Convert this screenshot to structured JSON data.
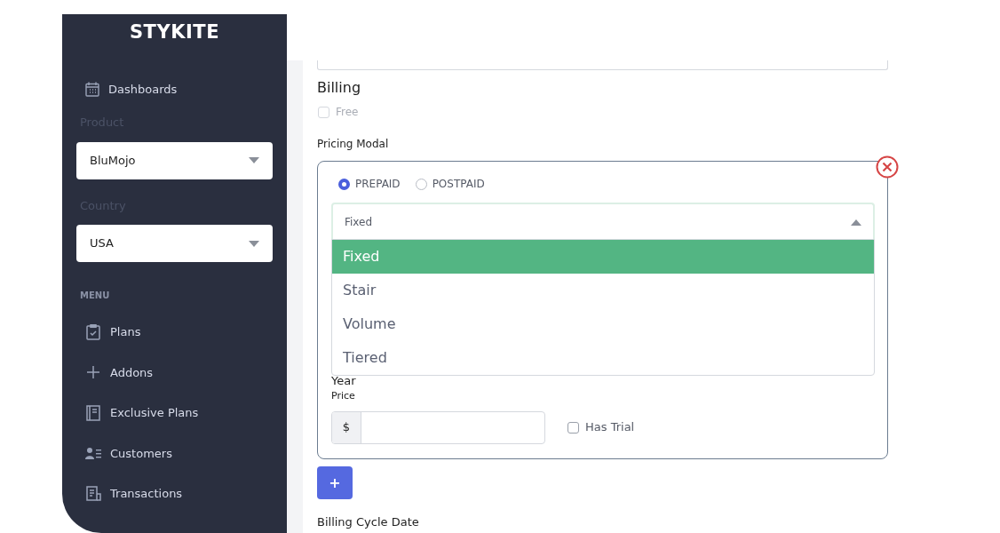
{
  "sidebar": {
    "logo": "STYKITE",
    "dashboard": {
      "label": "Dashboards"
    },
    "product": {
      "label": "Product",
      "value": "BluMojo"
    },
    "country": {
      "label": "Country",
      "value": "USA"
    },
    "menu_heading": "MENU",
    "items": [
      {
        "label": "Plans"
      },
      {
        "label": "Addons"
      },
      {
        "label": "Exclusive Plans"
      },
      {
        "label": "Customers"
      },
      {
        "label": "Transactions"
      }
    ]
  },
  "billing": {
    "title": "Billing",
    "free": {
      "label": "Free",
      "checked": false,
      "disabled": true
    },
    "pricing_label": "Pricing Modal",
    "payment_types": [
      {
        "label": "PREPAID",
        "selected": true
      },
      {
        "label": "POSTPAID",
        "selected": false
      }
    ],
    "model_select": {
      "value": "Fixed",
      "expanded": true,
      "options": [
        {
          "label": "Fixed",
          "selected": true
        },
        {
          "label": "Stair",
          "selected": false
        },
        {
          "label": "Volume",
          "selected": false
        },
        {
          "label": "Tiered",
          "selected": false
        }
      ]
    },
    "year_label": "Year",
    "price_label": "Price",
    "currency": "$",
    "has_trial": {
      "label": "Has Trial",
      "checked": false
    },
    "add_button": "+",
    "cycle_label": "Billing Cycle Date"
  }
}
